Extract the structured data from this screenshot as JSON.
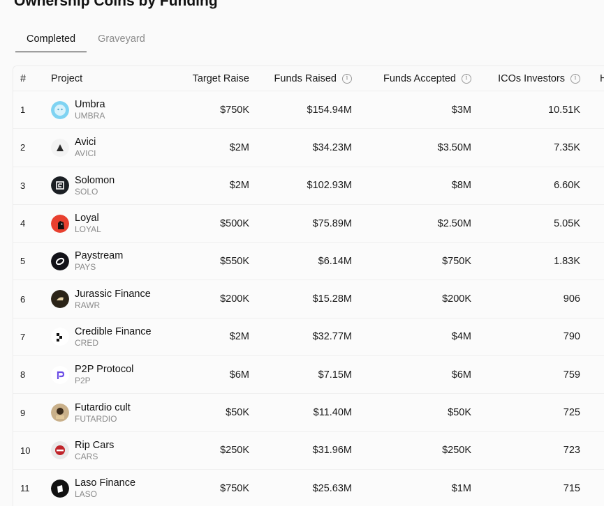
{
  "page_title": "Ownership Coins by Funding",
  "tabs": [
    {
      "label": "Completed",
      "active": true
    },
    {
      "label": "Graveyard",
      "active": false
    }
  ],
  "table": {
    "headers": {
      "num": "#",
      "project": "Project",
      "target": "Target Raise",
      "raised": "Funds Raised",
      "accepted": "Funds Accepted",
      "investors": "ICOs Investors",
      "extra": "H"
    },
    "rows": [
      {
        "num": "1",
        "name": "Umbra",
        "ticker": "UMBRA",
        "target": "$750K",
        "raised": "$154.94M",
        "accepted": "$3M",
        "investors": "10.51K",
        "logo": "umbra-logo-icon"
      },
      {
        "num": "2",
        "name": "Avici",
        "ticker": "AVICI",
        "target": "$2M",
        "raised": "$34.23M",
        "accepted": "$3.50M",
        "investors": "7.35K",
        "logo": "avici-logo-icon"
      },
      {
        "num": "3",
        "name": "Solomon",
        "ticker": "SOLO",
        "target": "$2M",
        "raised": "$102.93M",
        "accepted": "$8M",
        "investors": "6.60K",
        "logo": "solomon-logo-icon"
      },
      {
        "num": "4",
        "name": "Loyal",
        "ticker": "LOYAL",
        "target": "$500K",
        "raised": "$75.89M",
        "accepted": "$2.50M",
        "investors": "5.05K",
        "logo": "loyal-logo-icon"
      },
      {
        "num": "5",
        "name": "Paystream",
        "ticker": "PAYS",
        "target": "$550K",
        "raised": "$6.14M",
        "accepted": "$750K",
        "investors": "1.83K",
        "logo": "paystream-logo-icon"
      },
      {
        "num": "6",
        "name": "Jurassic Finance",
        "ticker": "RAWR",
        "target": "$200K",
        "raised": "$15.28M",
        "accepted": "$200K",
        "investors": "906",
        "logo": "jurassic-logo-icon"
      },
      {
        "num": "7",
        "name": "Credible Finance",
        "ticker": "CRED",
        "target": "$2M",
        "raised": "$32.77M",
        "accepted": "$4M",
        "investors": "790",
        "logo": "credible-logo-icon"
      },
      {
        "num": "8",
        "name": "P2P Protocol",
        "ticker": "P2P",
        "target": "$6M",
        "raised": "$7.15M",
        "accepted": "$6M",
        "investors": "759",
        "logo": "p2p-logo-icon"
      },
      {
        "num": "9",
        "name": "Futardio cult",
        "ticker": "FUTARDIO",
        "target": "$50K",
        "raised": "$11.40M",
        "accepted": "$50K",
        "investors": "725",
        "logo": "futardio-logo-icon"
      },
      {
        "num": "10",
        "name": "Rip Cars",
        "ticker": "CARS",
        "target": "$250K",
        "raised": "$31.96M",
        "accepted": "$250K",
        "investors": "723",
        "logo": "ripcars-logo-icon"
      },
      {
        "num": "11",
        "name": "Laso Finance",
        "ticker": "LASO",
        "target": "$750K",
        "raised": "$25.63M",
        "accepted": "$1M",
        "investors": "715",
        "logo": "laso-logo-icon"
      }
    ]
  },
  "colors": {
    "text": "#111111",
    "muted": "#8a8a8a",
    "border": "#ececec",
    "background": "#fafafa"
  }
}
